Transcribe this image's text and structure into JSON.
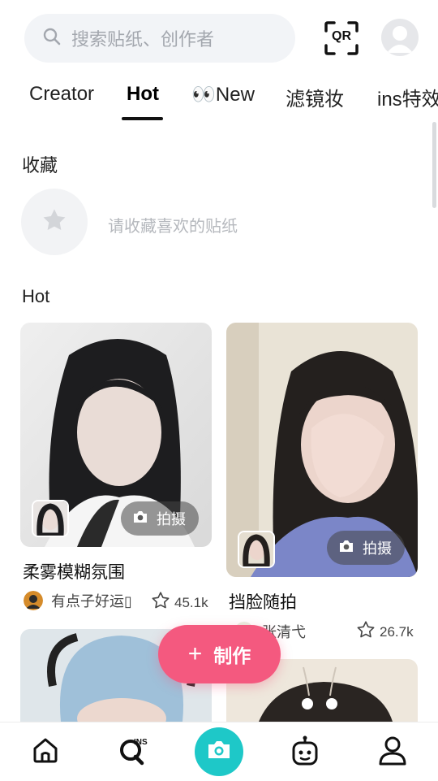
{
  "search": {
    "placeholder": "搜索贴纸、创作者"
  },
  "header": {
    "qr_label": "QR"
  },
  "tabs": [
    {
      "label": "Creator"
    },
    {
      "label": "Hot"
    },
    {
      "label": "👀New"
    },
    {
      "label": "滤镜妆"
    },
    {
      "label": "ins特效"
    }
  ],
  "favorites": {
    "title": "收藏",
    "hint": "请收藏喜欢的贴纸"
  },
  "hot": {
    "title": "Hot"
  },
  "cards": [
    {
      "title": "柔雾模糊氛围",
      "creator": "有点子好运▯",
      "likes": "45.1k",
      "shoot_label": "拍摄"
    },
    {
      "title": "挡脸随拍",
      "creator": "张清弋",
      "likes": "26.7k",
      "shoot_label": "拍摄"
    }
  ],
  "create_button": {
    "label": "制作"
  },
  "bottom_nav": {
    "items": [
      "home-icon",
      "ins-search-icon",
      "camera-icon",
      "robot-icon",
      "profile-icon"
    ],
    "camera_color": "#1ec8c8"
  },
  "colors": {
    "accent": "#f4597f",
    "teal": "#1ec8c8"
  }
}
